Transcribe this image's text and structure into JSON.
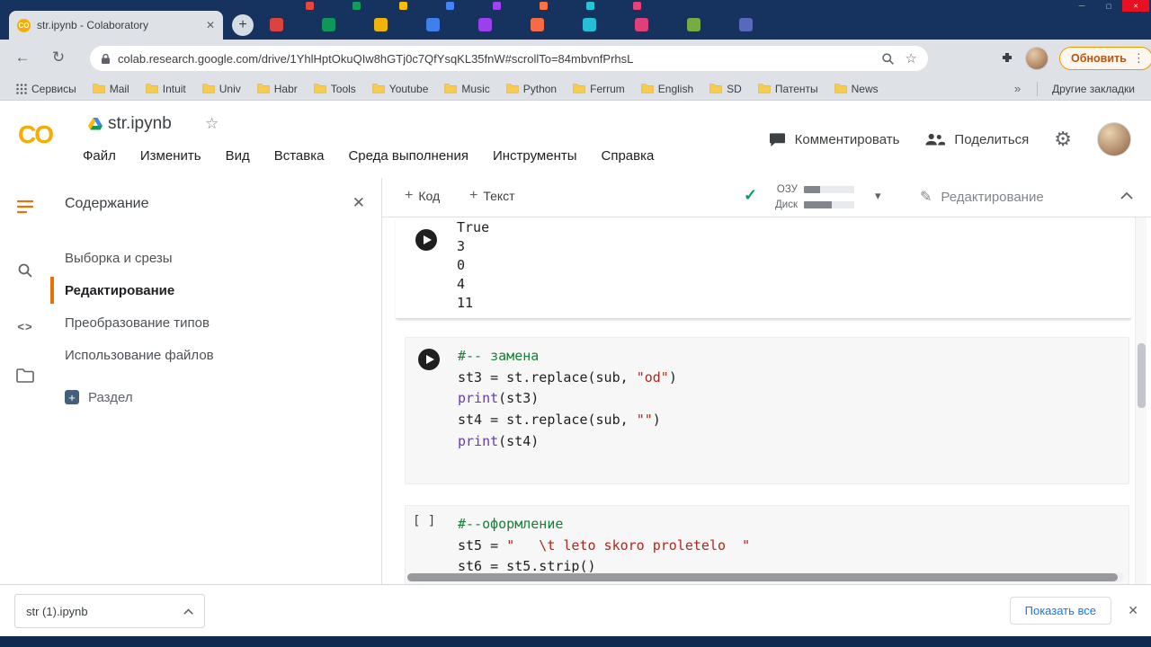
{
  "icons": {
    "back": "←",
    "reload": "↻",
    "star": "☆",
    "kebab": "⋮",
    "gear": "⚙",
    "pencil": "✎",
    "check": "✓",
    "caret_down": "▾",
    "close": "✕",
    "plus": "+",
    "code_brackets": "<>",
    "minimize": "—",
    "maximize": "▢"
  },
  "desktop": {
    "icon_colors": [
      "#e8453c",
      "#0f9d58",
      "#fbbc05",
      "#4285f4",
      "#a142f4",
      "#ff7043",
      "#26c6da",
      "#ec407a",
      "#7cb342",
      "#5c6bc0"
    ]
  },
  "browser": {
    "tab_title": "str.ipynb - Colaboratory",
    "url": "colab.research.google.com/drive/1YhlHptOkuQIw8hGTj0c7QfYsqKL35fnW#scrollTo=84mbvnfPrhsL",
    "update_button": "Обновить",
    "bookmarks": [
      "Сервисы",
      "Mail",
      "Intuit",
      "Univ",
      "Habr",
      "Tools",
      "Youtube",
      "Music",
      "Python",
      "Ferrum",
      "English",
      "SD",
      "Патенты",
      "News"
    ],
    "bookmarks_overflow": "»",
    "other_bookmarks": "Другие закладки",
    "downloads_bar": {
      "filename": "str (1).ipynb",
      "show_all": "Показать все"
    }
  },
  "colab": {
    "logo": "CO",
    "notebook_title": "str.ipynb",
    "menu": [
      "Файл",
      "Изменить",
      "Вид",
      "Вставка",
      "Среда выполнения",
      "Инструменты",
      "Справка"
    ],
    "header_actions": {
      "comment": "Комментировать",
      "share": "Поделиться"
    },
    "toolbar": {
      "add_code": "Код",
      "add_text": "Текст",
      "ram_label": "ОЗУ",
      "disk_label": "Диск",
      "ram_pct": 32,
      "disk_pct": 55,
      "mode": "Редактирование"
    },
    "sidebar": {
      "title": "Содержание",
      "items": [
        "Выборка и срезы",
        "Редактирование",
        "Преобразование типов",
        "Использование файлов"
      ],
      "active_index": 1,
      "add_section": "Раздел"
    },
    "cells": [
      {
        "kind": "output",
        "lines": [
          "True",
          "3",
          "0",
          "4",
          "11"
        ]
      },
      {
        "kind": "code",
        "marker": "play",
        "lines": [
          [
            {
              "t": "#-- замена",
              "c": "com"
            }
          ],
          [
            {
              "t": "st3 = st.replace(sub, ",
              "c": "pln"
            },
            {
              "t": "\"od\"",
              "c": "str"
            },
            {
              "t": ")",
              "c": "pln"
            }
          ],
          [
            {
              "t": "print",
              "c": "kw"
            },
            {
              "t": "(st3)",
              "c": "pln"
            }
          ],
          [
            {
              "t": "st4 = st.replace(sub, ",
              "c": "pln"
            },
            {
              "t": "\"\"",
              "c": "str"
            },
            {
              "t": ")",
              "c": "pln"
            }
          ],
          [
            {
              "t": "print",
              "c": "kw"
            },
            {
              "t": "(st4)",
              "c": "pln"
            }
          ]
        ]
      },
      {
        "kind": "code",
        "marker": "[ ]",
        "lines": [
          [
            {
              "t": "#--оформление",
              "c": "com"
            }
          ],
          [
            {
              "t": "st5 = ",
              "c": "pln"
            },
            {
              "t": "\"   \\t leto skoro proletelo  \"",
              "c": "str"
            }
          ],
          [
            {
              "t": "st6 = st5.strip()",
              "c": "pln"
            }
          ]
        ]
      }
    ]
  }
}
